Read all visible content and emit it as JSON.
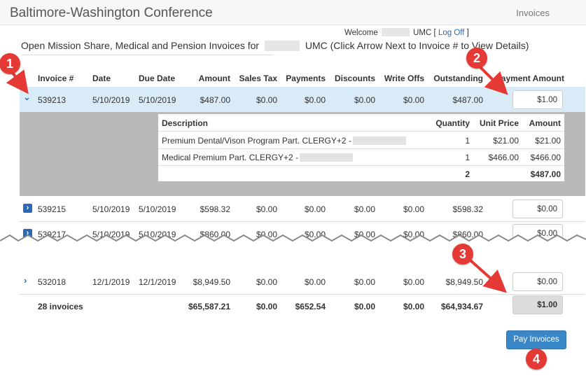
{
  "header": {
    "title": "Baltimore-Washington Conference",
    "nav_invoices": "Invoices"
  },
  "welcome": {
    "prefix": "Welcome",
    "umc": "UMC",
    "bracket_open": "[",
    "logoff": "Log Off",
    "bracket_close": "]"
  },
  "heading": {
    "before": "Open Mission Share, Medical and Pension Invoices for",
    "after": "UMC (Click Arrow Next to Invoice # to View Details)"
  },
  "table": {
    "headers": [
      "Invoice #",
      "Date",
      "Due Date",
      "Amount",
      "Sales Tax",
      "Payments",
      "Discounts",
      "Write Offs",
      "Outstanding",
      "Payment Amount"
    ],
    "rows": [
      {
        "invoice": "539213",
        "date": "5/10/2019",
        "due": "5/10/2019",
        "amount": "$487.00",
        "tax": "$0.00",
        "payments": "$0.00",
        "discounts": "$0.00",
        "writeoffs": "$0.00",
        "outstanding": "$487.00",
        "payment": "$1.00"
      },
      {
        "invoice": "539215",
        "date": "5/10/2019",
        "due": "5/10/2019",
        "amount": "$598.32",
        "tax": "$0.00",
        "payments": "$0.00",
        "discounts": "$0.00",
        "writeoffs": "$0.00",
        "outstanding": "$598.32",
        "payment": "$0.00"
      },
      {
        "invoice": "539217",
        "date": "5/10/2019",
        "due": "5/10/2019",
        "amount": "$860.00",
        "tax": "$0.00",
        "payments": "$0.00",
        "discounts": "$0.00",
        "writeoffs": "$0.00",
        "outstanding": "$860.00",
        "payment": "$0.00"
      },
      {
        "invoice": "532018",
        "date": "12/1/2019",
        "due": "12/1/2019",
        "amount": "$8,949.50",
        "tax": "$0.00",
        "payments": "$0.00",
        "discounts": "$0.00",
        "writeoffs": "$0.00",
        "outstanding": "$8,949.50",
        "payment": "$0.00"
      }
    ],
    "totals": {
      "count": "28 invoices",
      "amount": "$65,587.21",
      "tax": "$0.00",
      "payments": "$652.54",
      "discounts": "$0.00",
      "writeoffs": "$0.00",
      "outstanding": "$64,934.67",
      "payment": "$1.00"
    }
  },
  "detail": {
    "headers": [
      "Description",
      "Quantity",
      "Unit Price",
      "Amount"
    ],
    "rows": [
      {
        "description": "Premium Dental/Vison Program Part. CLERGY+2 -",
        "quantity": "1",
        "unit_price": "$21.00",
        "amount": "$21.00"
      },
      {
        "description": "Medical Premium Part. CLERGY+2 -",
        "quantity": "1",
        "unit_price": "$466.00",
        "amount": "$466.00"
      }
    ],
    "total_quantity": "2",
    "total_amount": "$487.00"
  },
  "pay_button": "Pay Invoices",
  "badges": [
    "1",
    "2",
    "3",
    "4"
  ],
  "icons": {
    "expand_open": "chevron-down-icon",
    "expand_closed": "chevron-right-icon"
  },
  "colors": {
    "accent": "#2a6ab4",
    "row_highlight": "#d9ebf7",
    "annotation": "#e53935",
    "button": "#3a87c8"
  }
}
